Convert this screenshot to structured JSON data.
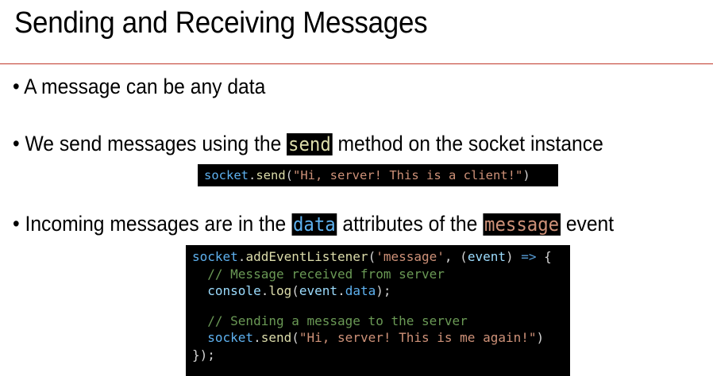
{
  "title": "Sending and Receiving Messages",
  "bullets": [
    {
      "text": "A message can be any data"
    },
    {
      "before": "We send messages using the ",
      "code": "send",
      "after": " method on the socket instance"
    },
    {
      "before": "Incoming messages are in the ",
      "code": "data",
      "mid": " attributes of the ",
      "code2": "message",
      "after": " event"
    }
  ],
  "bullet_char": "•",
  "colors": {
    "rule": "#c0392b",
    "code_bg": "#000000",
    "variable": "#5eb1ef",
    "function": "#dcdcaa",
    "string": "#ce9178",
    "comment": "#6a9955"
  },
  "code1": [
    [
      [
        "socket",
        "var"
      ],
      [
        ".",
        "p"
      ],
      [
        "send",
        "fn"
      ],
      [
        "(",
        "p"
      ],
      [
        "\"Hi, server! This is a client!\"",
        "str"
      ],
      [
        ")",
        "p"
      ]
    ]
  ],
  "code2": [
    [
      [
        "socket",
        "var"
      ],
      [
        ".",
        "p"
      ],
      [
        "addEventListener",
        "fn"
      ],
      [
        "(",
        "p"
      ],
      [
        "'message'",
        "str"
      ],
      [
        ", (",
        "p"
      ],
      [
        "event",
        "prop"
      ],
      [
        ") ",
        "p"
      ],
      [
        "=>",
        "kw"
      ],
      [
        " {",
        "p"
      ]
    ],
    [
      [
        "  // Message received from server",
        "com"
      ]
    ],
    [
      [
        "  ",
        "p"
      ],
      [
        "console",
        "prop"
      ],
      [
        ".",
        "p"
      ],
      [
        "log",
        "fn"
      ],
      [
        "(",
        "p"
      ],
      [
        "event",
        "prop"
      ],
      [
        ".",
        "p"
      ],
      [
        "data",
        "var"
      ],
      [
        ");",
        "p"
      ]
    ],
    [
      [
        "",
        "p"
      ]
    ],
    [
      [
        "  // Sending a message to the server",
        "com"
      ]
    ],
    [
      [
        "  ",
        "p"
      ],
      [
        "socket",
        "var"
      ],
      [
        ".",
        "p"
      ],
      [
        "send",
        "fn"
      ],
      [
        "(",
        "p"
      ],
      [
        "\"Hi, server! This is me again!\"",
        "str"
      ],
      [
        ")",
        "p"
      ]
    ],
    [
      [
        "});",
        "p"
      ]
    ]
  ]
}
